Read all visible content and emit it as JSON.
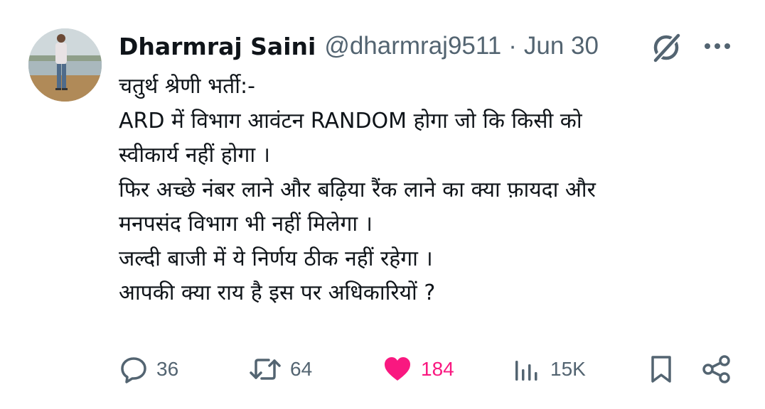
{
  "tweet": {
    "author": {
      "display_name": "Dharmraj Saini",
      "handle": "@dharmraj9511",
      "separator": "·",
      "date": "Jun 30"
    },
    "lines": [
      "चतुर्थ श्रेणी भर्ती:-",
      "ARD में विभाग आवंटन RANDOM होगा जो कि किसी को",
      "स्वीकार्य नहीं होगा ।",
      "फिर अच्छे नंबर लाने और बढ़िया रैंक लाने का क्या फ़ायदा और",
      "मनपसंद विभाग भी नहीं मिलेगा ।",
      "जल्दी बाजी में ये निर्णय ठीक नहीं रहेगा ।",
      "आपकी क्या राय है इस पर अधिकारियों ?"
    ],
    "actions": {
      "replies": "36",
      "reposts": "64",
      "likes": "184",
      "views": "15K"
    },
    "icons": [
      "grok-icon",
      "more-icon",
      "reply-icon",
      "repost-icon",
      "like-icon",
      "views-icon",
      "bookmark-icon",
      "share-icon"
    ],
    "colors": {
      "text": "#0f1419",
      "secondary": "#536471",
      "like": "#f91880"
    }
  }
}
